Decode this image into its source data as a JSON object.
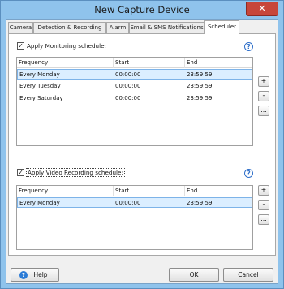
{
  "window": {
    "title": "New Capture Device",
    "close_glyph": "✕"
  },
  "tabs": [
    {
      "label": "Camera",
      "active": false
    },
    {
      "label": "Detection & Recording",
      "active": false
    },
    {
      "label": "Alarm",
      "active": false
    },
    {
      "label": "Email & SMS Notifications",
      "active": false
    },
    {
      "label": "Scheduler",
      "active": true
    }
  ],
  "monitoring": {
    "checkbox_label": "Apply Monitoring schedule:",
    "checked": true,
    "columns": [
      "Frequency",
      "Start",
      "End"
    ],
    "rows": [
      {
        "frequency": "Every Monday",
        "start": "00:00:00",
        "end": "23:59:59",
        "selected": true
      },
      {
        "frequency": "Every Tuesday",
        "start": "00:00:00",
        "end": "23:59:59",
        "selected": false
      },
      {
        "frequency": "Every Saturday",
        "start": "00:00:00",
        "end": "23:59:59",
        "selected": false
      }
    ]
  },
  "recording": {
    "checkbox_label": "Apply Video Recording schedule:",
    "checked": true,
    "columns": [
      "Frequency",
      "Start",
      "End"
    ],
    "rows": [
      {
        "frequency": "Every Monday",
        "start": "00:00:00",
        "end": "23:59:59",
        "selected": true
      }
    ]
  },
  "side_buttons": {
    "add": "+",
    "remove": "-",
    "edit": "..."
  },
  "help_glyph": "?",
  "checkmark": "✓",
  "footer": {
    "help_label": "Help",
    "ok_label": "OK",
    "cancel_label": "Cancel"
  },
  "colors": {
    "window_frame": "#8fc3ec",
    "selection": "#dbeeff",
    "close_button": "#c7463a",
    "help_icon": "#2b7bd6"
  }
}
